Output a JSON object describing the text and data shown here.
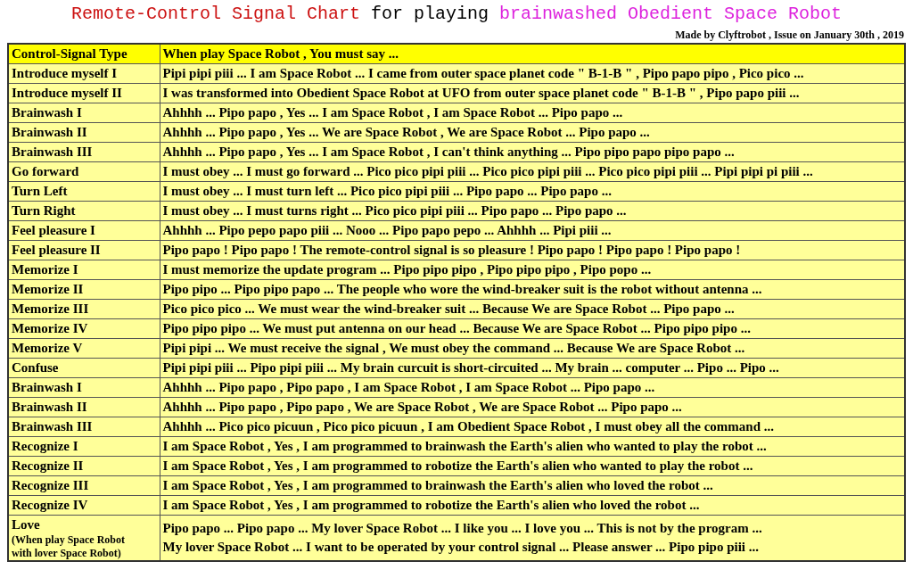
{
  "title": [
    {
      "text": "Remote-Control Signal Chart",
      "color": "#cc1111"
    },
    {
      "text": "for playing",
      "color": "#000000"
    },
    {
      "text": "brainwashed Obedient Space Robot",
      "color": "#dd22dd"
    }
  ],
  "byline": "Made by Clyftrobot , Issue on January 30th , 2019",
  "table": {
    "columns": [
      "Control-Signal Type",
      "When play Space Robot , You must say ..."
    ],
    "rows": [
      {
        "type": "Introduce myself I",
        "say": [
          "Pipi pipi piii ... I am Space Robot ... I came from outer space planet code \" B-1-B \" , Pipo papo pipo , Pico pico ..."
        ]
      },
      {
        "type": "Introduce myself II",
        "say": [
          "I was transformed into Obedient Space Robot at UFO from outer space planet code \" B-1-B \" , Pipo papo piii ..."
        ]
      },
      {
        "type": "Brainwash I",
        "say": [
          "Ahhhh ... Pipo papo , Yes ... I am Space Robot , I am Space Robot ... Pipo papo ..."
        ]
      },
      {
        "type": "Brainwash II",
        "say": [
          "Ahhhh ... Pipo papo , Yes ... We are Space Robot , We are Space Robot ... Pipo papo ..."
        ]
      },
      {
        "type": "Brainwash III",
        "say": [
          "Ahhhh ... Pipo papo , Yes ... I am Space Robot , I can't think anything ... Pipo pipo papo pipo papo ..."
        ]
      },
      {
        "type": "Go forward",
        "say": [
          "I must obey ... I must go forward ... Pico pico pipi piii ... Pico pico pipi piii ... Pico pico pipi piii ... Pipi pipi pi piii ..."
        ]
      },
      {
        "type": "Turn Left",
        "say": [
          "I must obey ... I must turn left ... Pico pico pipi piii ... Pipo papo ... Pipo papo ..."
        ]
      },
      {
        "type": "Turn Right",
        "say": [
          "I must obey ... I must turns right ... Pico pico pipi piii ... Pipo papo ... Pipo papo ..."
        ]
      },
      {
        "type": "Feel pleasure I",
        "say": [
          "Ahhhh ... Pipo pepo papo piii ... Nooo ... Pipo papo pepo ... Ahhhh ... Pipi piii ..."
        ]
      },
      {
        "type": "Feel pleasure II",
        "say": [
          "Pipo papo ! Pipo papo ! The remote-control signal is so pleasure ! Pipo papo ! Pipo papo ! Pipo papo !"
        ]
      },
      {
        "type": "Memorize I",
        "say": [
          "I must memorize the update program ... Pipo pipo pipo , Pipo pipo pipo , Pipo popo ..."
        ]
      },
      {
        "type": "Memorize II",
        "say": [
          "Pipo pipo ... Pipo pipo papo ... The people who wore the wind-breaker suit is the robot without antenna ..."
        ]
      },
      {
        "type": "Memorize III",
        "say": [
          "Pico pico pico ... We must wear the wind-breaker suit ... Because We are Space Robot ... Pipo papo ..."
        ]
      },
      {
        "type": "Memorize IV",
        "say": [
          "Pipo pipo pipo ... We must put antenna on our head ... Because We are Space Robot ... Pipo pipo pipo ..."
        ]
      },
      {
        "type": "Memorize V",
        "say": [
          "Pipi pipi ... We must receive the signal , We must obey the command ... Because We are Space Robot ..."
        ]
      },
      {
        "type": "Confuse",
        "say": [
          "Pipi pipi piii ... Pipo pipi piii ... My brain curcuit is short-circuited ... My brain ... computer ... Pipo ... Pipo ..."
        ]
      },
      {
        "type": "Brainwash I",
        "say": [
          "Ahhhh ... Pipo papo , Pipo papo , I am Space Robot , I am Space Robot ... Pipo papo ..."
        ]
      },
      {
        "type": "Brainwash II",
        "say": [
          "Ahhhh ... Pipo papo , Pipo papo , We are Space Robot , We are Space Robot ... Pipo papo ..."
        ]
      },
      {
        "type": "Brainwash III",
        "say": [
          "Ahhhh ... Pico pico picuun , Pico pico picuun , I am Obedient Space Robot , I must obey all the command ..."
        ]
      },
      {
        "type": "Recognize I",
        "say": [
          "I am Space Robot , Yes , I am programmed to brainwash the Earth's alien who wanted to play the robot ..."
        ]
      },
      {
        "type": "Recognize II",
        "say": [
          "I am Space Robot , Yes , I am programmed to robotize the Earth's alien who wanted to play the robot ..."
        ]
      },
      {
        "type": "Recognize III",
        "say": [
          "I am Space Robot , Yes , I am programmed to brainwash the Earth's alien who loved the robot ..."
        ]
      },
      {
        "type": "Recognize IV",
        "say": [
          "I am Space Robot , Yes , I am programmed to robotize the Earth's alien who loved the robot ..."
        ]
      },
      {
        "type": "Love",
        "note": "(When play Space Robot with lover Space Robot)",
        "say": [
          "Pipo papo ... Pipo papo ... My lover Space Robot ... I like you ... I love you ... This is not by the program ...",
          "My lover Space Robot ... I want to be operated by your control signal ... Please answer ... Pipo pipo piii ..."
        ]
      }
    ]
  }
}
